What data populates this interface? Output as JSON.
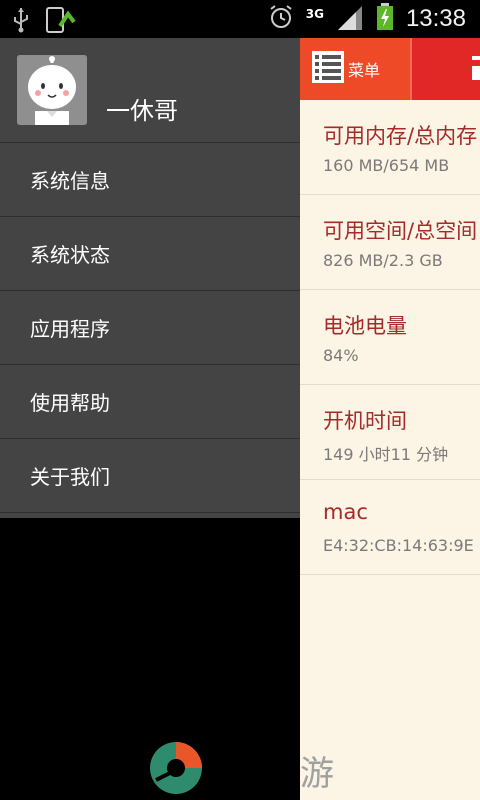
{
  "status_bar": {
    "time": "13:38",
    "network": "3G",
    "icons": [
      "usb-icon",
      "download-icon",
      "alarm-icon",
      "signal-icon",
      "battery-charging-icon"
    ]
  },
  "drawer": {
    "username": "一休哥",
    "items": [
      {
        "label": "系统信息"
      },
      {
        "label": "系统状态"
      },
      {
        "label": "应用程序"
      },
      {
        "label": "使用帮助"
      },
      {
        "label": "关于我们"
      }
    ]
  },
  "toolbar": {
    "menu_label": "菜单",
    "accent": "#e22727",
    "menu_color": "#ee4a28"
  },
  "info": [
    {
      "title": "可用内存/总内存",
      "value": "160 MB/654 MB"
    },
    {
      "title": "可用空间/总空间",
      "value": "826 MB/2.3 GB"
    },
    {
      "title": "电池电量",
      "value": "84%"
    },
    {
      "title": "开机时间",
      "value": "149 小时11 分钟"
    },
    {
      "title": "mac",
      "value": "E4:32:CB:14:63:9E"
    }
  ],
  "watermark": {
    "text": "游"
  },
  "colors": {
    "drawer_bg": "#444444",
    "content_bg": "#fcf4e4",
    "title_color": "#a52a2a",
    "value_color": "#7a7a7a"
  }
}
